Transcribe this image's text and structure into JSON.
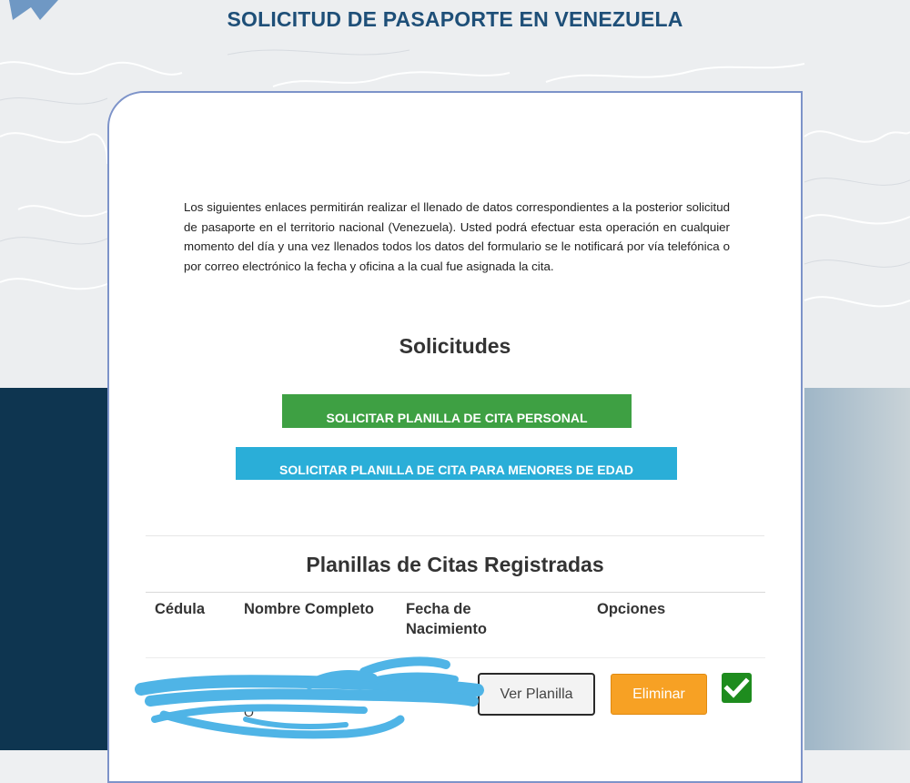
{
  "page": {
    "title": "SOLICITUD DE PASAPORTE EN VENEZUELA"
  },
  "intro": {
    "text": "Los siguientes enlaces permitirán realizar el llenado de datos correspondientes a la posterior solicitud de pasaporte en el territorio nacional (Venezuela). Usted podrá efectuar esta operación en cualquier momento del día y una vez llenados todos los datos del formulario se le notificará por vía telefónica o por correo electrónico la fecha y oficina a la cual fue asignada la cita."
  },
  "solicitudes": {
    "heading": "Solicitudes",
    "personal_button": "SOLICITAR PLANILLA DE CITA PERSONAL",
    "menores_button": "SOLICITAR PLANILLA DE CITA PARA MENORES DE EDAD"
  },
  "planillas": {
    "heading": "Planillas de Citas Registradas",
    "columns": [
      "Cédula",
      "Nombre Completo",
      "Fecha de Nacimiento",
      "Opciones"
    ],
    "rows": [
      {
        "value_fragment": "O",
        "ver_label": "Ver Planilla",
        "eliminar_label": "Eliminar"
      }
    ]
  },
  "colors": {
    "title": "#1e4f78",
    "green_button": "#3ea043",
    "blue_button": "#2aaed8",
    "eliminar": "#f7a124",
    "check": "#1e8c1e",
    "dark_navy": "#0e3550",
    "card_border": "#7d93c9",
    "redaction": "#4fb4e6"
  },
  "icons": {
    "corner": "star-icon",
    "selected": "checkmark-icon"
  }
}
